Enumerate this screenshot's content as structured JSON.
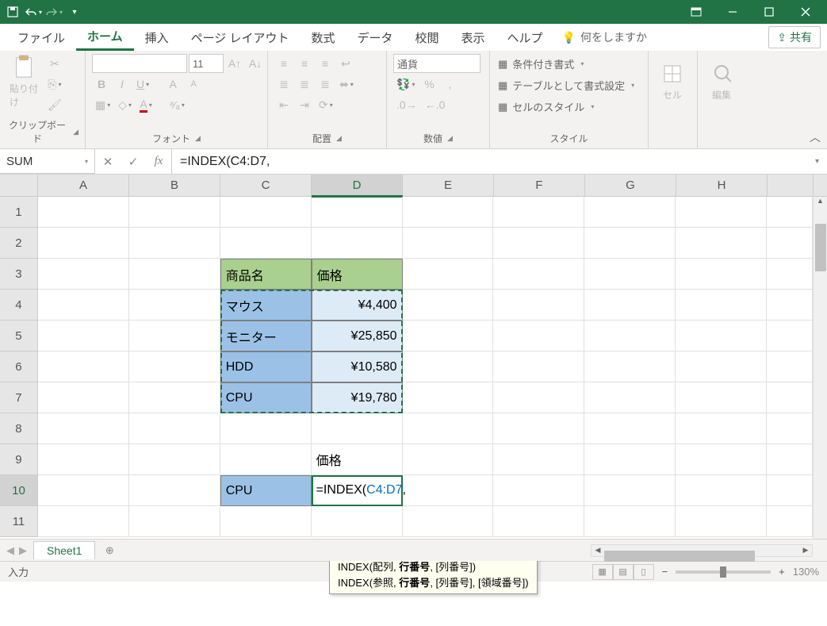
{
  "titlebar": {
    "save": "💾",
    "undo": "↶",
    "redo": "↷"
  },
  "tabs": {
    "file": "ファイル",
    "home": "ホーム",
    "insert": "挿入",
    "page_layout": "ページ レイアウト",
    "formulas": "数式",
    "data": "データ",
    "review": "校閲",
    "view": "表示",
    "help": "ヘルプ",
    "tell_me": "何をしますか",
    "share": "共有"
  },
  "ribbon": {
    "clipboard": {
      "paste": "貼り付け",
      "label": "クリップボード"
    },
    "font": {
      "name_placeholder": "",
      "size": "11",
      "label": "フォント"
    },
    "alignment": {
      "label": "配置"
    },
    "number": {
      "format": "通貨",
      "label": "数値"
    },
    "styles": {
      "conditional": "条件付き書式",
      "table": "テーブルとして書式設定",
      "cell_styles": "セルのスタイル",
      "label": "スタイル"
    },
    "cells": {
      "label": "セル"
    },
    "editing": {
      "label": "編集"
    }
  },
  "namebox": "SUM",
  "formula_bar": "=INDEX(C4:D7,",
  "columns": [
    "A",
    "B",
    "C",
    "D",
    "E",
    "F",
    "G",
    "H"
  ],
  "rows": [
    "1",
    "2",
    "3",
    "4",
    "5",
    "6",
    "7",
    "8",
    "9",
    "10",
    "11"
  ],
  "cells": {
    "C3": "商品名",
    "D3": "価格",
    "C4": "マウス",
    "D4": "¥4,400",
    "C5": "モニター",
    "D5": "¥25,850",
    "C6": "HDD",
    "D6": "¥10,580",
    "C7": "CPU",
    "D7": "¥19,780",
    "D9": "価格",
    "C10": "CPU",
    "D10_prefix": "=INDEX(",
    "D10_ref": "C4:D7",
    "D10_suffix": ","
  },
  "tooltip": {
    "line1_a": "INDEX(配列, ",
    "line1_b": "行番号",
    "line1_c": ", [列番号])",
    "line2_a": "INDEX(参照, ",
    "line2_b": "行番号",
    "line2_c": ", [列番号], [領域番号])"
  },
  "sheet": {
    "name": "Sheet1"
  },
  "status": {
    "mode": "入力",
    "zoom": "130%"
  }
}
